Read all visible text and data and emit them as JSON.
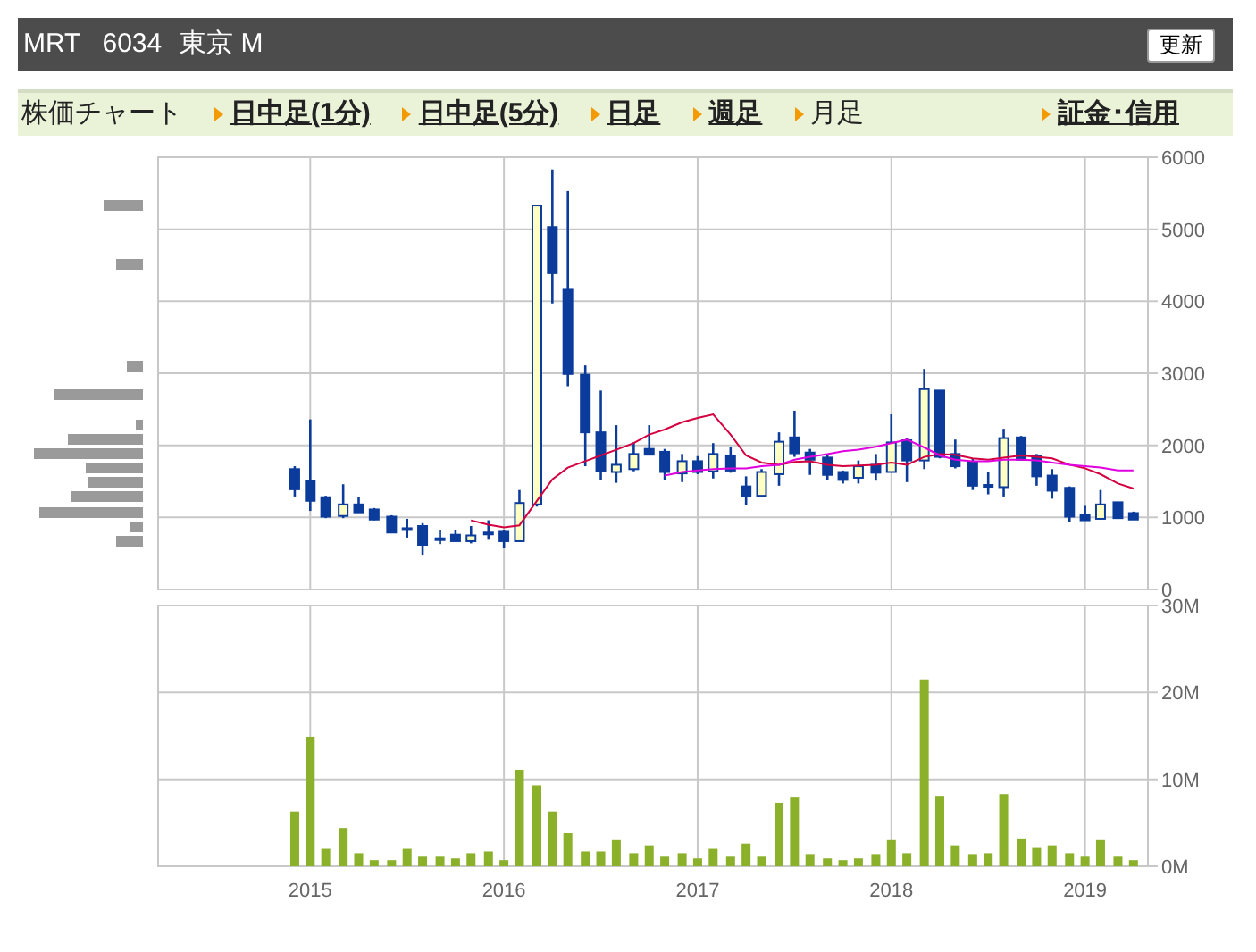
{
  "header": {
    "ticker": "MRT",
    "code": "6034",
    "market": "東京 M",
    "refresh_button": "更新"
  },
  "nav": {
    "label": "株価チャート",
    "tabs": [
      {
        "label": "日中足(1分)",
        "selected": false
      },
      {
        "label": "日中足(5分)",
        "selected": false
      },
      {
        "label": "日足",
        "selected": false
      },
      {
        "label": "週足",
        "selected": false
      },
      {
        "label": "月足",
        "selected": true
      }
    ],
    "link": "証金･信用"
  },
  "price_chart": {
    "chart_data": {
      "type": "candlestick",
      "grid": true,
      "xlim": [
        2014.21,
        2019.32
      ],
      "x": [
        2014.92,
        2015.0,
        2015.08,
        2015.17,
        2015.25,
        2015.33,
        2015.42,
        2015.5,
        2015.58,
        2015.67,
        2015.75,
        2015.83,
        2015.92,
        2016.0,
        2016.08,
        2016.17,
        2016.25,
        2016.33,
        2016.42,
        2016.5,
        2016.58,
        2016.67,
        2016.75,
        2016.83,
        2016.92,
        2017.0,
        2017.08,
        2017.17,
        2017.25,
        2017.33,
        2017.42,
        2017.5,
        2017.58,
        2017.67,
        2017.75,
        2017.83,
        2017.92,
        2018.0,
        2018.08,
        2018.17,
        2018.25,
        2018.33,
        2018.42,
        2018.5,
        2018.58,
        2018.67,
        2018.75,
        2018.83,
        2018.92,
        2019.0,
        2019.08,
        2019.17,
        2019.25
      ],
      "ohlc": [
        [
          1670,
          1710,
          1290,
          1390
        ],
        [
          1510,
          2360,
          1090,
          1230
        ],
        [
          1280,
          1300,
          990,
          1010
        ],
        [
          1020,
          1460,
          990,
          1180
        ],
        [
          1180,
          1280,
          1070,
          1070
        ],
        [
          1110,
          1130,
          960,
          970
        ],
        [
          1010,
          1030,
          790,
          790
        ],
        [
          850,
          980,
          720,
          840
        ],
        [
          880,
          920,
          470,
          620
        ],
        [
          710,
          830,
          630,
          700
        ],
        [
          760,
          830,
          670,
          670
        ],
        [
          670,
          880,
          640,
          750
        ],
        [
          780,
          960,
          690,
          790
        ],
        [
          800,
          820,
          570,
          670
        ],
        [
          670,
          1380,
          670,
          1200
        ],
        [
          1180,
          5330,
          1150,
          5330
        ],
        [
          5030,
          5830,
          3970,
          4390
        ],
        [
          4160,
          5530,
          2820,
          2990
        ],
        [
          2980,
          3110,
          1710,
          2180
        ],
        [
          2180,
          2760,
          1520,
          1640
        ],
        [
          1630,
          2280,
          1480,
          1730
        ],
        [
          1670,
          2040,
          1640,
          1880
        ],
        [
          1950,
          2280,
          1870,
          1870
        ],
        [
          1910,
          1950,
          1520,
          1630
        ],
        [
          1610,
          1880,
          1490,
          1780
        ],
        [
          1780,
          1850,
          1600,
          1630
        ],
        [
          1640,
          2030,
          1540,
          1880
        ],
        [
          1860,
          1980,
          1620,
          1650
        ],
        [
          1430,
          1570,
          1170,
          1290
        ],
        [
          1300,
          1670,
          1300,
          1630
        ],
        [
          1600,
          2180,
          1440,
          2050
        ],
        [
          2110,
          2480,
          1840,
          1890
        ],
        [
          1900,
          1950,
          1590,
          1800
        ],
        [
          1830,
          1870,
          1520,
          1590
        ],
        [
          1630,
          1650,
          1470,
          1520
        ],
        [
          1550,
          1790,
          1470,
          1710
        ],
        [
          1730,
          1880,
          1510,
          1620
        ],
        [
          1630,
          2430,
          1630,
          2040
        ],
        [
          2070,
          2100,
          1490,
          1790
        ],
        [
          1790,
          3060,
          1670,
          2780
        ],
        [
          2760,
          2760,
          1820,
          1840
        ],
        [
          1880,
          2080,
          1680,
          1710
        ],
        [
          1770,
          1820,
          1380,
          1440
        ],
        [
          1450,
          1630,
          1320,
          1450
        ],
        [
          1420,
          2230,
          1290,
          2100
        ],
        [
          2110,
          2130,
          1800,
          1800
        ],
        [
          1850,
          1880,
          1440,
          1570
        ],
        [
          1580,
          1670,
          1260,
          1370
        ],
        [
          1410,
          1430,
          940,
          1010
        ],
        [
          1030,
          1160,
          960,
          960
        ],
        [
          980,
          1380,
          980,
          1180
        ],
        [
          1210,
          1210,
          990,
          990
        ],
        [
          1060,
          1080,
          970,
          970
        ]
      ],
      "series": [
        {
          "type": "line",
          "color": "#d40040",
          "values": [
            null,
            null,
            null,
            null,
            null,
            null,
            null,
            null,
            null,
            null,
            null,
            960,
            900,
            860,
            890,
            1230,
            1530,
            1690,
            1780,
            1860,
            1940,
            2030,
            2150,
            2220,
            2320,
            2380,
            2430,
            2150,
            1860,
            1760,
            1730,
            1770,
            1780,
            1730,
            1710,
            1720,
            1730,
            1760,
            1730,
            1840,
            1880,
            1870,
            1820,
            1800,
            1830,
            1860,
            1840,
            1820,
            1730,
            1680,
            1600,
            1470,
            1400
          ]
        },
        {
          "type": "line",
          "color": "#e000e0",
          "values": [
            null,
            null,
            null,
            null,
            null,
            null,
            null,
            null,
            null,
            null,
            null,
            null,
            null,
            null,
            null,
            null,
            null,
            null,
            null,
            null,
            null,
            null,
            null,
            1580,
            1630,
            1650,
            1670,
            1680,
            1680,
            1710,
            1730,
            1800,
            1840,
            1880,
            1920,
            1940,
            1980,
            2030,
            2080,
            1970,
            1860,
            1800,
            1780,
            1780,
            1800,
            1800,
            1790,
            1760,
            1730,
            1710,
            1690,
            1650,
            1650
          ]
        }
      ],
      "ylim": [
        0,
        6000
      ],
      "yticks": [
        0,
        1000,
        2000,
        3000,
        4000,
        5000,
        6000
      ]
    }
  },
  "volume_chart": {
    "chart_data": {
      "type": "bar",
      "grid": true,
      "xlim": [
        2014.21,
        2019.32
      ],
      "x": [
        2014.92,
        2015.0,
        2015.08,
        2015.17,
        2015.25,
        2015.33,
        2015.42,
        2015.5,
        2015.58,
        2015.67,
        2015.75,
        2015.83,
        2015.92,
        2016.0,
        2016.08,
        2016.17,
        2016.25,
        2016.33,
        2016.42,
        2016.5,
        2016.58,
        2016.67,
        2016.75,
        2016.83,
        2016.92,
        2017.0,
        2017.08,
        2017.17,
        2017.25,
        2017.33,
        2017.42,
        2017.5,
        2017.58,
        2017.67,
        2017.75,
        2017.83,
        2017.92,
        2018.0,
        2018.08,
        2018.17,
        2018.25,
        2018.33,
        2018.42,
        2018.5,
        2018.58,
        2018.67,
        2018.75,
        2018.83,
        2018.92,
        2019.0,
        2019.08,
        2019.17,
        2019.25
      ],
      "series": [
        {
          "color": "#8bb02a",
          "values": [
            6.3,
            14.9,
            2.0,
            4.4,
            1.5,
            0.7,
            0.7,
            2.0,
            1.1,
            1.1,
            0.9,
            1.5,
            1.7,
            0.7,
            11.1,
            9.3,
            6.3,
            3.8,
            1.7,
            1.7,
            3.0,
            1.5,
            2.4,
            1.1,
            1.5,
            0.9,
            2.0,
            1.1,
            2.6,
            1.1,
            7.3,
            8.0,
            1.4,
            0.9,
            0.7,
            0.9,
            1.4,
            3.0,
            1.5,
            21.5,
            8.1,
            2.4,
            1.4,
            1.5,
            8.3,
            3.2,
            2.2,
            2.4,
            1.5,
            1.1,
            3.0,
            1.1,
            0.7
          ]
        }
      ],
      "ylim": [
        0,
        30
      ],
      "yticks": [
        {
          "value": 0,
          "label": "0M"
        },
        {
          "value": 10,
          "label": "10M"
        },
        {
          "value": 20,
          "label": "20M"
        },
        {
          "value": 30,
          "label": "30M"
        }
      ],
      "xticks": [
        {
          "value": 2015,
          "label": "2015"
        },
        {
          "value": 2016,
          "label": "2016"
        },
        {
          "value": 2017,
          "label": "2017"
        },
        {
          "value": 2018,
          "label": "2018"
        },
        {
          "value": 2019,
          "label": "2019"
        }
      ]
    }
  }
}
